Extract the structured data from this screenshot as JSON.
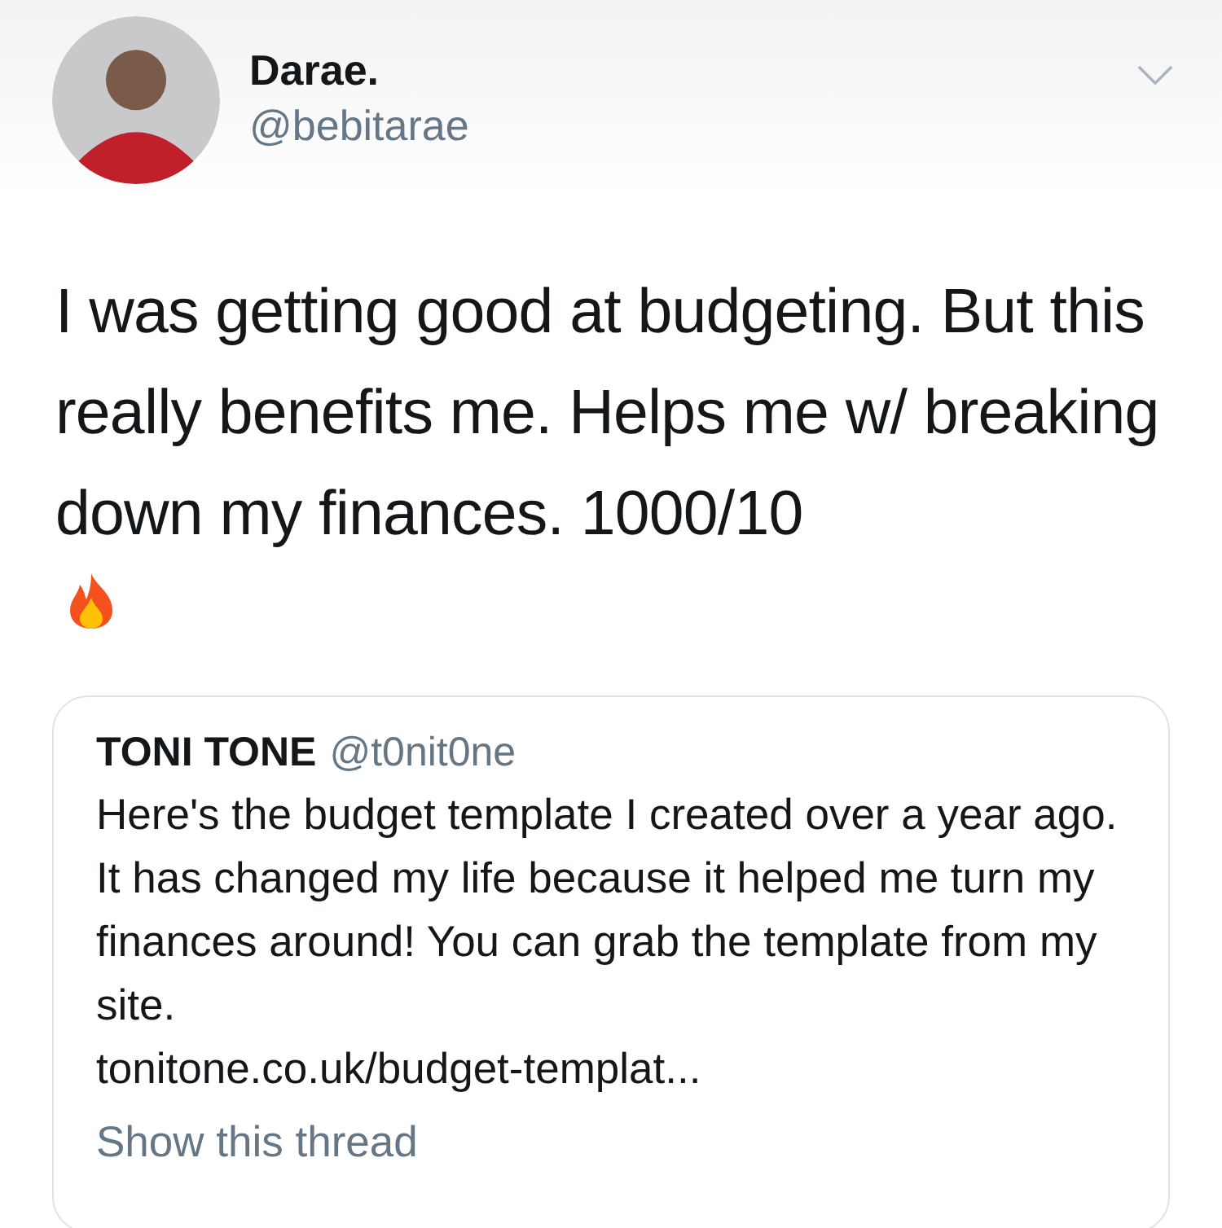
{
  "author": {
    "name": "Darae.",
    "handle": "@bebitarae"
  },
  "tweet": {
    "text": "I was getting good at budgeting. But this really benefits me. Helps me w/ breaking down my finances. 1000/10"
  },
  "quoted_tweet": {
    "name": "TONI TONE",
    "handle": "@t0nit0ne",
    "text": "Here's the budget template I created over a year ago. It has changed my life because it helped me turn my finances around! You can grab the template from my site.",
    "link": "tonitone.co.uk/budget-templat...",
    "show_thread": "Show this thread"
  }
}
